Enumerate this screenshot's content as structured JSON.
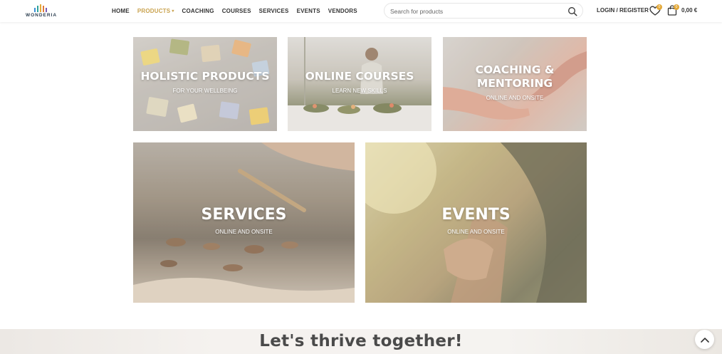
{
  "brand": {
    "name": "WONDERIA"
  },
  "nav": {
    "items": [
      {
        "label": "HOME",
        "active": false
      },
      {
        "label": "PRODUCTS",
        "active": true
      },
      {
        "label": "COACHING",
        "active": false
      },
      {
        "label": "COURSES",
        "active": false
      },
      {
        "label": "SERVICES",
        "active": false
      },
      {
        "label": "EVENTS",
        "active": false
      },
      {
        "label": "VENDORS",
        "active": false
      }
    ]
  },
  "search": {
    "placeholder": "Search for products"
  },
  "account": {
    "login_label": "LOGIN / REGISTER"
  },
  "wishlist": {
    "count": "0"
  },
  "cart": {
    "count": "0",
    "total": "0,00 €"
  },
  "tiles": [
    {
      "title": "HOLISTIC PRODUCTS",
      "subtitle": "FOR YOUR WELLBEING"
    },
    {
      "title": "ONLINE COURSES",
      "subtitle": "LEARN NEW SKILLS"
    },
    {
      "title_line1": "COACHING &",
      "title_line2": "MENTORING",
      "subtitle": "ONLINE AND ONSITE"
    },
    {
      "title": "SERVICES",
      "subtitle": "ONLINE AND ONSITE"
    },
    {
      "title": "EVENTS",
      "subtitle": "ONLINE AND ONSITE"
    }
  ],
  "band": {
    "title": "Let's thrive together!"
  },
  "colors": {
    "accent": "#c9a24e",
    "badge": "#e3a93a",
    "text": "#333333"
  }
}
